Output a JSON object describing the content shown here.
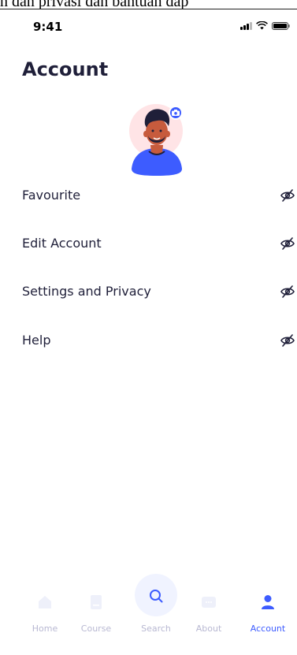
{
  "top_caption": "n dan privasi dan bantuan dap",
  "status_bar": {
    "time": "9:41"
  },
  "page": {
    "title": "Account"
  },
  "menu": {
    "items": [
      {
        "label": "Favourite",
        "icon": "eye-off-icon"
      },
      {
        "label": "Edit Account",
        "icon": "eye-off-icon"
      },
      {
        "label": "Settings and Privacy",
        "icon": "eye-off-icon"
      },
      {
        "label": "Help",
        "icon": "eye-off-icon"
      }
    ]
  },
  "tabs": [
    {
      "label": "Home",
      "icon": "home-icon"
    },
    {
      "label": "Course",
      "icon": "book-icon"
    },
    {
      "label": "Search",
      "icon": "search-icon"
    },
    {
      "label": "About",
      "icon": "message-icon"
    },
    {
      "label": "Account",
      "icon": "person-icon",
      "active": true
    }
  ],
  "colors": {
    "accent": "#3d5cff",
    "text": "#1f1f39",
    "muted": "#b8b8d2",
    "avatar_bg": "#ffe4e6",
    "search_bg": "#f0f3ff"
  }
}
